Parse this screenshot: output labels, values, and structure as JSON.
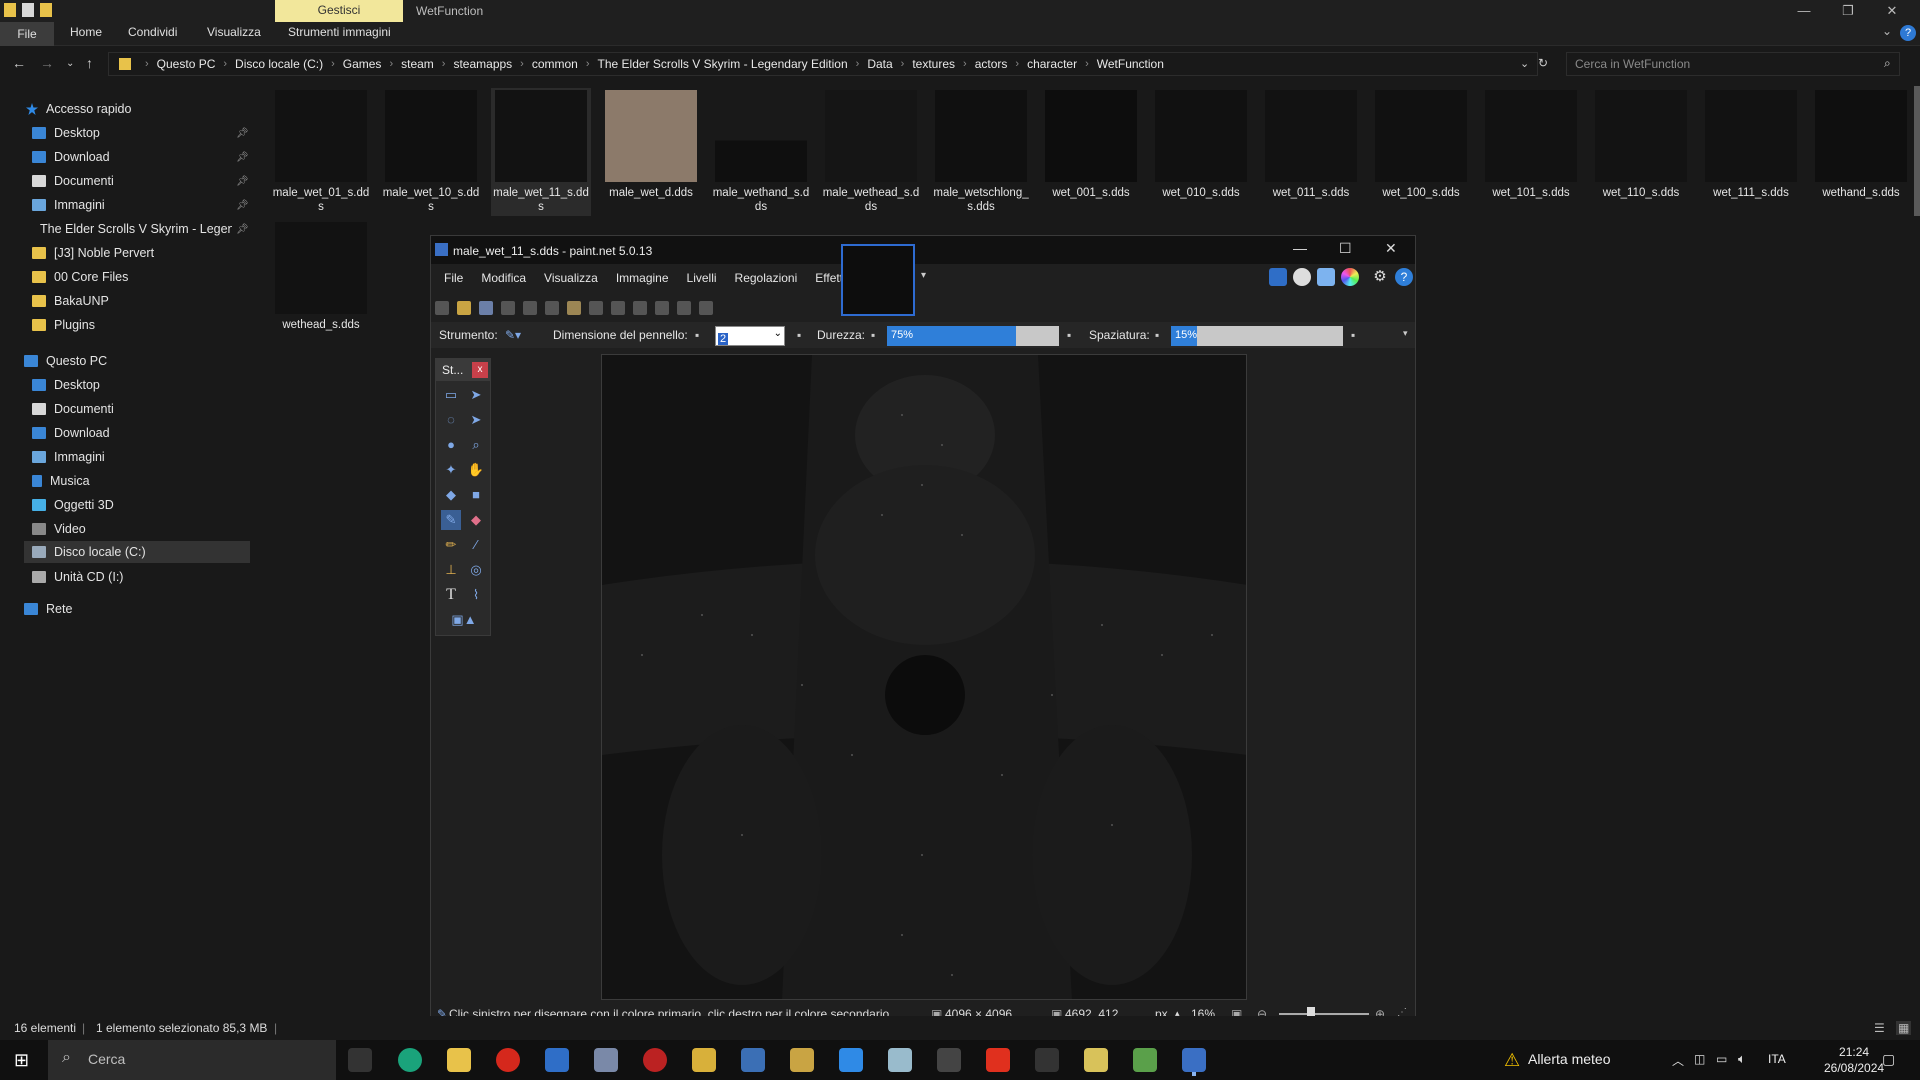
{
  "explorer": {
    "context_tab": "Gestisci",
    "window_title": "WetFunction",
    "ribbon_tabs": [
      "File",
      "Home",
      "Condividi",
      "Visualizza",
      "Strumenti immagini"
    ],
    "breadcrumbs": [
      "Questo PC",
      "Disco locale (C:)",
      "Games",
      "steam",
      "steamapps",
      "common",
      "The Elder Scrolls V Skyrim - Legendary Edition",
      "Data",
      "textures",
      "actors",
      "character",
      "WetFunction"
    ],
    "search_placeholder": "Cerca in WetFunction",
    "nav": {
      "quick_access": "Accesso rapido",
      "quick_items": [
        "Desktop",
        "Download",
        "Documenti",
        "Immagini",
        "The Elder Scrolls V Skyrim - Legendary Edition",
        "[J3] Noble Pervert",
        "00 Core Files",
        "BakaUNP",
        "Plugins"
      ],
      "this_pc": "Questo PC",
      "pc_items": [
        "Desktop",
        "Documenti",
        "Download",
        "Immagini",
        "Musica",
        "Oggetti 3D",
        "Video",
        "Disco locale (C:)",
        "Unità CD (I:)"
      ],
      "network": "Rete"
    },
    "files": [
      "male_wet_01_s.dds",
      "male_wet_10_s.dds",
      "male_wet_11_s.dds",
      "male_wet_d.dds",
      "male_wethand_s.dds",
      "male_wethead_s.dds",
      "male_wetschlong_s.dds",
      "wet_001_s.dds",
      "wet_010_s.dds",
      "wet_011_s.dds",
      "wet_100_s.dds",
      "wet_101_s.dds",
      "wet_110_s.dds",
      "wet_111_s.dds",
      "wethand_s.dds",
      "wethead_s.dds"
    ],
    "status": {
      "count": "16 elementi",
      "selection": "1 elemento selezionato  85,3 MB"
    }
  },
  "paintnet": {
    "title": "male_wet_11_s.dds - paint.net 5.0.13",
    "menu": [
      "File",
      "Modifica",
      "Visualizza",
      "Immagine",
      "Livelli",
      "Regolazioni",
      "Effetti"
    ],
    "options": {
      "tool_label": "Strumento:",
      "brush_label": "Dimensione del pennello:",
      "brush_value": "2",
      "hardness_label": "Durezza:",
      "hardness_value": "75%",
      "hardness_fraction": 0.75,
      "spacing_label": "Spaziatura:",
      "spacing_value": "15%",
      "spacing_fraction": 0.15
    },
    "tools_header": "St...",
    "status": {
      "hint": "Clic sinistro per disegnare con il colore primario, clic destro per il colore secondario.",
      "size": "4096 × 4096",
      "coords": "4692, 412",
      "unit": "px",
      "zoom": "16%"
    }
  },
  "taskbar": {
    "search": "Cerca",
    "weather": "Allerta meteo",
    "lang": "ITA",
    "time": "21:24",
    "date": "26/08/2024"
  }
}
